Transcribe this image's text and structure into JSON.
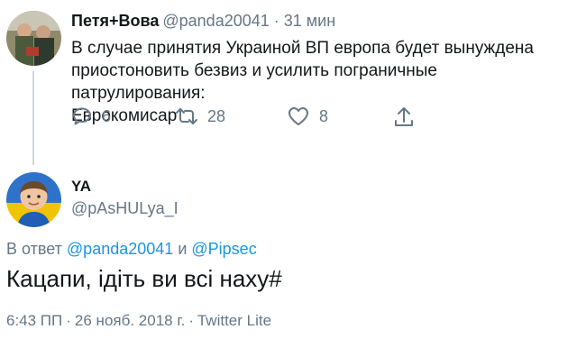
{
  "tweet1": {
    "author_name": "Петя+Вова",
    "handle": "@panda20041",
    "separator": "·",
    "time": "31 мин",
    "text_line1": "В случае принятия Украиной ВП европа будет вынуждена",
    "text_line2": "приостоновить безвиз и усилить пограничные патрулирования:",
    "text_line3": "Еврокомисар",
    "replies": "6",
    "retweets": "28",
    "likes": "8",
    "icons": [
      "reply-icon",
      "retweet-icon",
      "like-icon",
      "share-icon"
    ]
  },
  "tweet2": {
    "author_name": "YA",
    "handle": "@pAsHULya_I",
    "reply_prefix": "В ответ",
    "reply_mention1": "@panda20041",
    "reply_and": "и",
    "reply_mention2": "@Pipsec",
    "text": "Кацапи, ідіть ви всі наху#",
    "time": "6:43 ПП",
    "separator": "·",
    "date": "26 нояб. 2018 г.",
    "source": "Twitter Lite"
  },
  "colors": {
    "text": "#14171a",
    "secondary": "#657786",
    "link": "#1b95e0",
    "thread_line": "#ccd6dd"
  }
}
